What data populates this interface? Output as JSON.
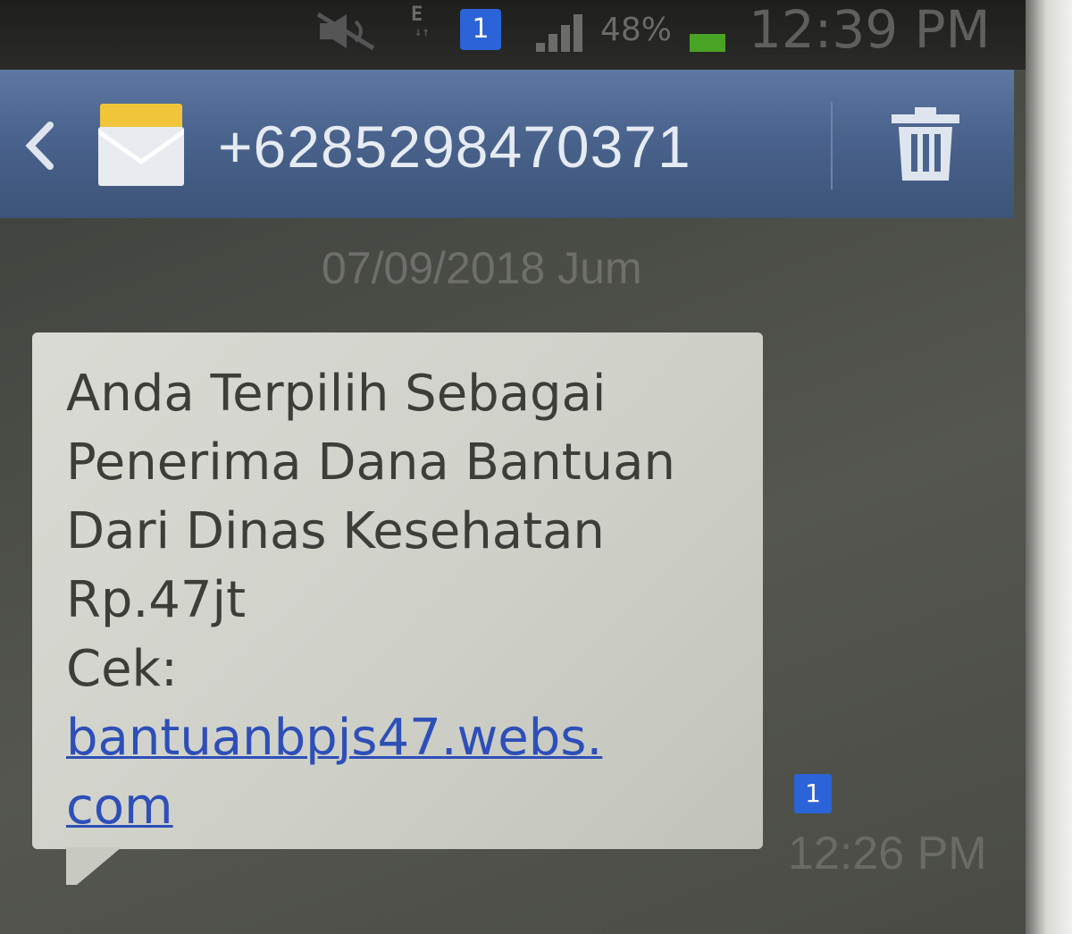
{
  "status_bar": {
    "network_label": "E",
    "notification_badge": "1",
    "battery_percent": "48%",
    "time": "12:39 PM",
    "icons": [
      "mute-icon",
      "signal-icon",
      "battery-icon"
    ],
    "battery_color": "#49a324"
  },
  "header": {
    "contact": "+6285298470371",
    "icons": [
      "back-icon",
      "envelope-icon",
      "trash-icon"
    ]
  },
  "conversation": {
    "date": "07/09/2018 Jum",
    "message": {
      "lines": [
        "Anda Terpilih Sebagai",
        "Penerima Dana Bantuan",
        "Dari Dinas Kesehatan",
        "Rp.47jt",
        "Cek:"
      ],
      "link_lines": [
        "bantuanbpjs47.webs.",
        "com"
      ],
      "sim_badge": "1",
      "time": "12:26 PM"
    }
  },
  "colors": {
    "action_bar": "#4a638d",
    "badge": "#2b63d8",
    "link": "#2e4fb8"
  }
}
